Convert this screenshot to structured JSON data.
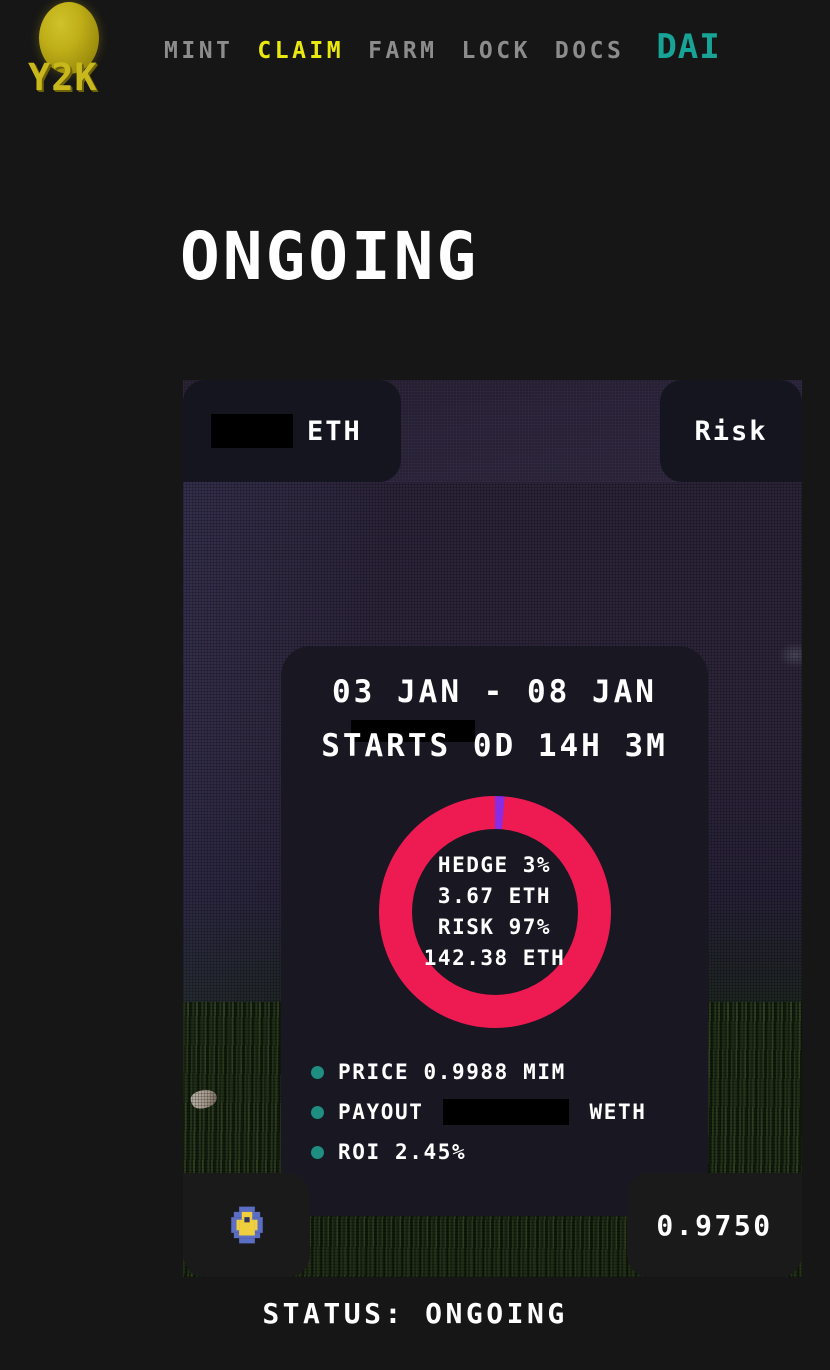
{
  "header": {
    "brand": {
      "logo_icon": "y2k-orb-logo",
      "wordmark": "Y2K"
    },
    "nav": [
      {
        "label": "MINT",
        "active": false,
        "style": "gray"
      },
      {
        "label": "CLAIM",
        "active": true,
        "style": "yellow"
      },
      {
        "label": "FARM",
        "active": false,
        "style": "gray"
      },
      {
        "label": "LOCK",
        "active": false,
        "style": "gray"
      },
      {
        "label": "DOCS",
        "active": false,
        "style": "gray"
      },
      {
        "label": "DAI",
        "active": false,
        "style": "teal"
      }
    ],
    "accent_active": "#e9e90f",
    "accent_teal": "#17a497",
    "nav_inactive": "#8c8c8c"
  },
  "page": {
    "title": "ONGOING",
    "status_line": "STATUS: ONGOING"
  },
  "card": {
    "tabs": {
      "left": {
        "redacted": true,
        "label": "ETH"
      },
      "right": {
        "label": "Risk"
      }
    },
    "detail": {
      "date_range": "03 JAN - 08 JAN",
      "countdown": "STARTS 0D 14H 3M",
      "countdown_redacted": true
    },
    "donut": {
      "lines": [
        "HEDGE 3%",
        "3.67 ETH",
        "RISK 97%",
        "142.38 ETH"
      ]
    },
    "stats": [
      {
        "label": "PRICE 0.9988 MIM",
        "redacted": false
      },
      {
        "label_before": "PAYOUT",
        "redacted": true,
        "label_after": "WETH"
      },
      {
        "label": "ROI 2.45%",
        "redacted": false
      }
    ],
    "footer": {
      "token_icon": "mim-token-icon",
      "price_value": "0.9750"
    }
  },
  "chart_data": {
    "type": "pie",
    "title": "Hedge vs Risk allocation",
    "categories": [
      "HEDGE",
      "RISK"
    ],
    "values": [
      3,
      97
    ],
    "value_labels": [
      "3.67 ETH",
      "142.38 ETH"
    ],
    "units": "percent",
    "colors": [
      "#8b2be2",
      "#ee1b52"
    ],
    "donut": true,
    "hole_ratio": 0.715,
    "start_angle_deg": -6,
    "legend": "center-labels"
  },
  "colors": {
    "risk": "#ee1b52",
    "hedge": "#8b2be2",
    "dot_teal": "#1d8e81",
    "panel_bg": "#191722",
    "page_bg": "#161616",
    "redaction": "#000000"
  }
}
